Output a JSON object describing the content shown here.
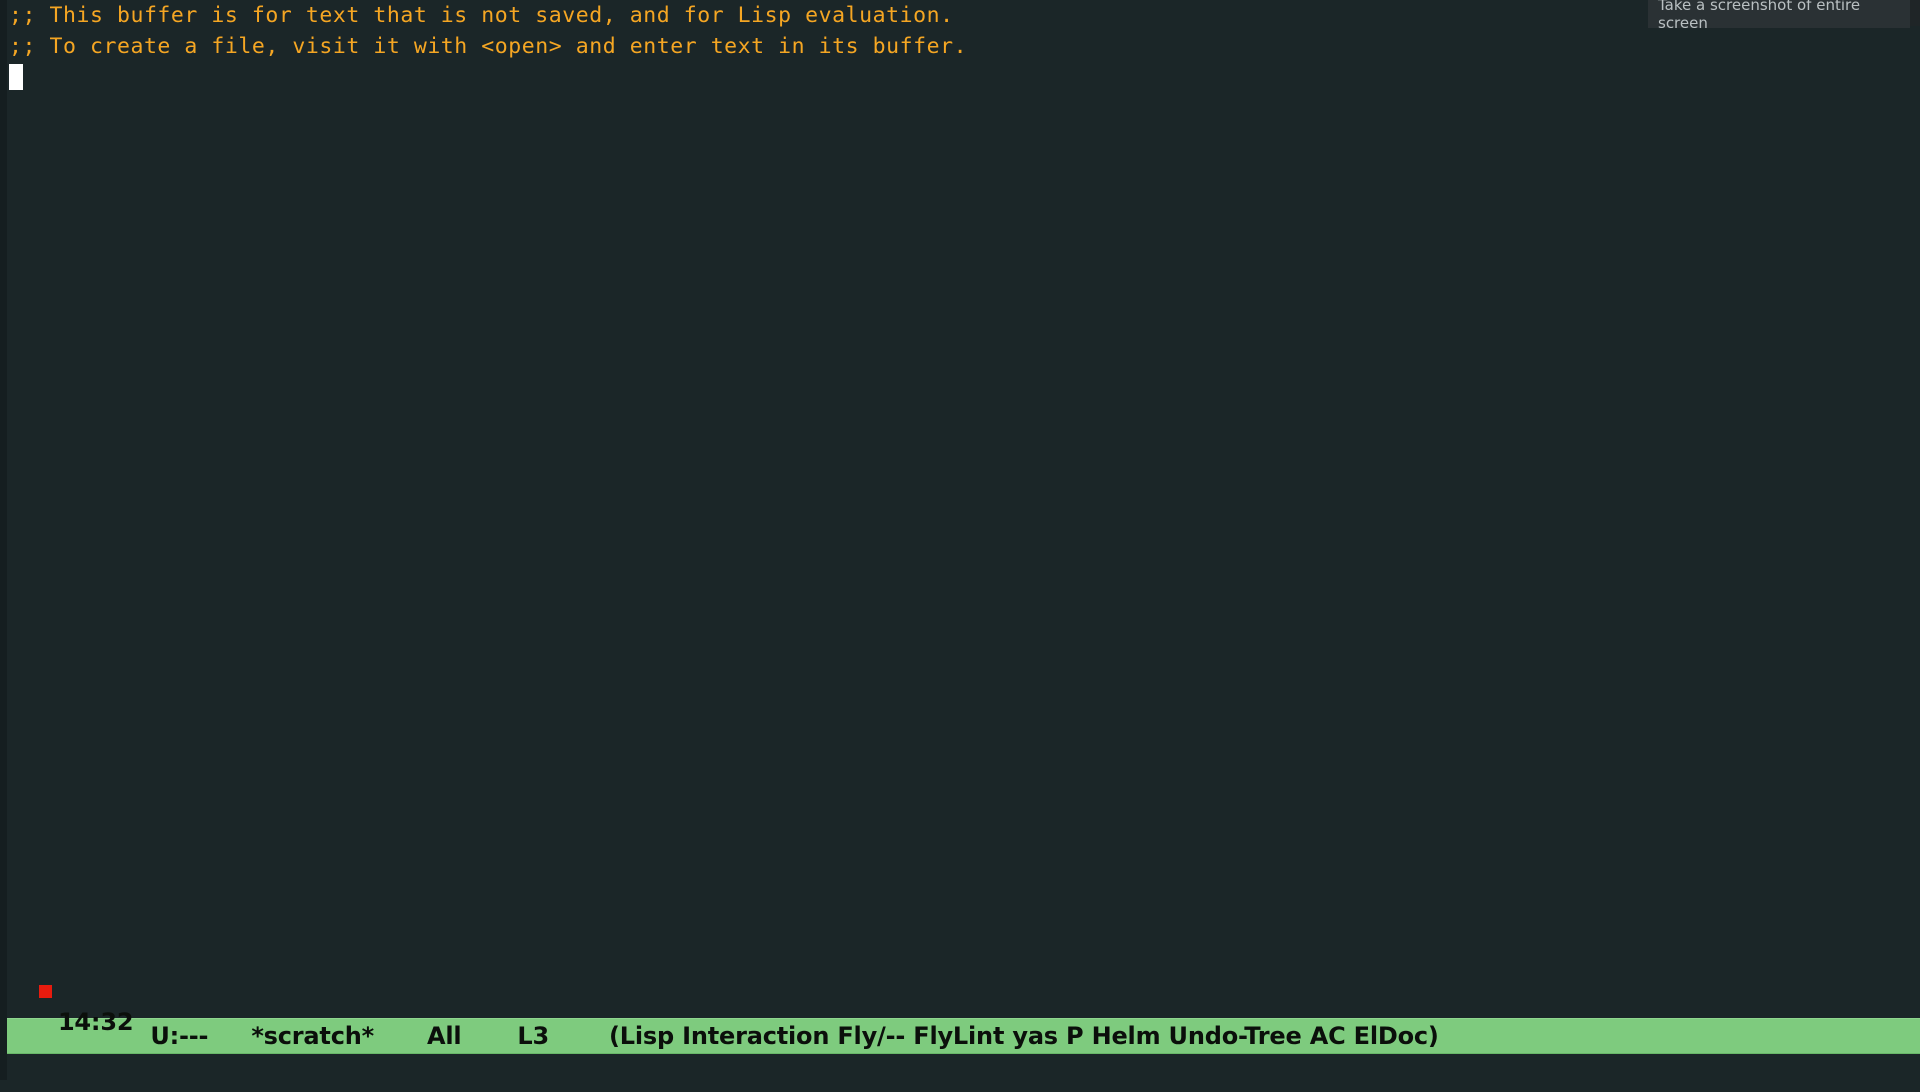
{
  "frame": {
    "background_color": "#1b2628",
    "foreground_color": "#f5a623"
  },
  "buffer": {
    "name": "*scratch*",
    "lines": [
      ";; This buffer is for text that is not saved, and for Lisp evaluation.",
      ";; To create a file, visit it with <open> and enter text in its buffer.",
      ""
    ],
    "cursor": {
      "line": 3,
      "column": 0,
      "style": "block",
      "color": "#ffffff"
    }
  },
  "mode_line": {
    "background_color": "#7ecb7e",
    "foreground_color": "#0b0f0b",
    "clock": "14:32",
    "mail_indicator_color": "#e81b0e",
    "encoding": "U:---",
    "buffer_name": "*scratch*",
    "position_indicator": "All",
    "line_number": "L3",
    "modes": "(Lisp Interaction Fly/-- FlyLint yas P Helm Undo-Tree AC ElDoc)"
  },
  "minibuffer": {
    "text": ""
  },
  "tooltip": {
    "text": "Take a screenshot of entire screen",
    "background_color": "#2a3134",
    "foreground_color": "#b9c0c2"
  }
}
